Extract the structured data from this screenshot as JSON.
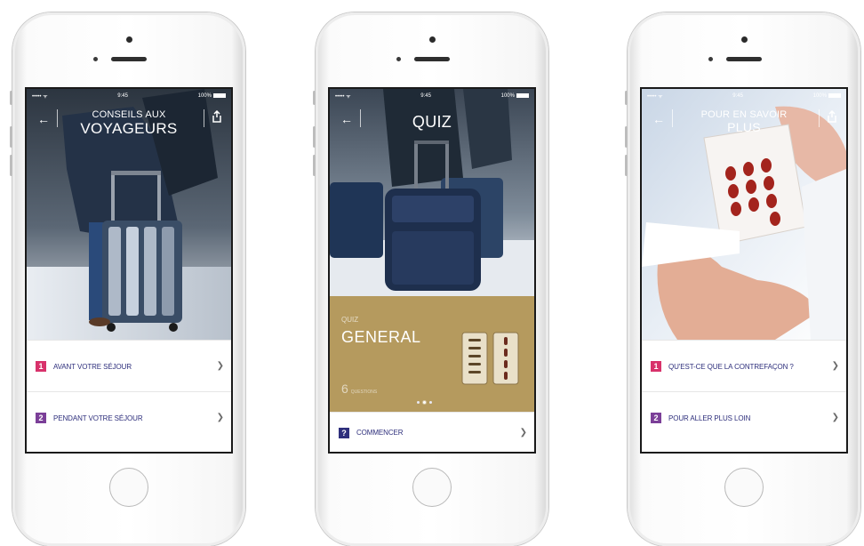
{
  "status_bar": {
    "carrier": "••••• ᯤ",
    "time": "9:45",
    "battery": "100%"
  },
  "screens": [
    {
      "title_line1": "CONSEILS AUX",
      "title_line2": "VOYAGEURS",
      "rows": [
        {
          "number": "1",
          "label": "AVANT VOTRE SÉJOUR",
          "color": "#d8326b"
        },
        {
          "number": "2",
          "label": "PENDANT VOTRE SÉJOUR",
          "color": "#7b3f98"
        }
      ]
    },
    {
      "title_line1": "QUIZ",
      "quiz_panel": {
        "subtitle": "QUIZ",
        "title": "GENERAL",
        "count": "6",
        "count_suffix": "QUESTIONS",
        "active_page": 1,
        "page_count": 3
      },
      "rows": [
        {
          "number": "?",
          "label": "COMMENCER",
          "color": "#2e2f7c"
        }
      ]
    },
    {
      "title_line1": "POUR EN SAVOIR",
      "title_line2": "PLUS",
      "rows": [
        {
          "number": "1",
          "label": "QU'EST-CE QUE LA CONTREFAÇON ?",
          "color": "#d8326b"
        },
        {
          "number": "2",
          "label": "POUR ALLER PLUS LOIN",
          "color": "#7b3f98"
        }
      ]
    }
  ],
  "icons": [
    "back-arrow-icon",
    "share-icon",
    "chevron-right-icon",
    "signal-icon",
    "battery-icon"
  ]
}
